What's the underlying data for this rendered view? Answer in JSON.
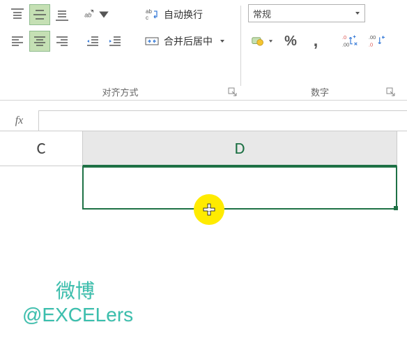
{
  "ribbon": {
    "align_group_label": "对齐方式",
    "number_group_label": "数字",
    "wrap_text": "自动换行",
    "merge_center": "合并后居中",
    "number_format_selected": "常规"
  },
  "formula_bar": {
    "fx": "fx",
    "value": ""
  },
  "sheet": {
    "columns": {
      "c": "C",
      "d": "D"
    },
    "selected_cell": "D1"
  },
  "watermark": {
    "line1": "微博",
    "line2": "@EXCELers"
  }
}
